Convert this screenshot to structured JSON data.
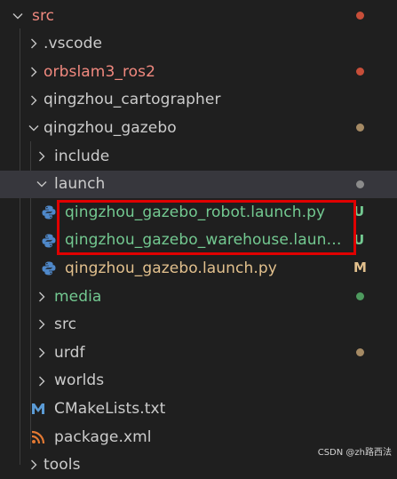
{
  "colors": {
    "default_text": "#cccccc",
    "error_text": "#f1897f",
    "untracked_text": "#73c991",
    "modified_text": "#e2c08d",
    "error_dot": "#c74e39",
    "modified_dot": "#a58a64",
    "untracked_dot": "#4e9a5e",
    "neutral_dot": "#8b8b8b",
    "highlight_border": "#e00000"
  },
  "explorer": {
    "items": [
      {
        "label": "src",
        "kind": "folder",
        "expanded": true,
        "color": "error_text",
        "status_dot": "error_dot",
        "badge": ""
      },
      {
        "label": ".vscode",
        "kind": "folder",
        "expanded": false,
        "color": "default_text",
        "status_dot": "",
        "badge": ""
      },
      {
        "label": "orbslam3_ros2",
        "kind": "folder",
        "expanded": false,
        "color": "error_text",
        "status_dot": "error_dot",
        "badge": ""
      },
      {
        "label": "qingzhou_cartographer",
        "kind": "folder",
        "expanded": false,
        "color": "default_text",
        "status_dot": "",
        "badge": ""
      },
      {
        "label": "qingzhou_gazebo",
        "kind": "folder",
        "expanded": true,
        "color": "default_text",
        "status_dot": "modified_dot",
        "badge": ""
      },
      {
        "label": "include",
        "kind": "folder",
        "expanded": false,
        "color": "default_text",
        "status_dot": "",
        "badge": ""
      },
      {
        "label": "launch",
        "kind": "folder",
        "expanded": true,
        "color": "default_text",
        "status_dot": "neutral_dot",
        "badge": ""
      },
      {
        "label": "qingzhou_gazebo_robot.launch.py",
        "kind": "python",
        "color": "untracked_text",
        "status_dot": "",
        "badge": "U"
      },
      {
        "label": "qingzhou_gazebo_warehouse.launc...",
        "kind": "python",
        "color": "untracked_text",
        "status_dot": "",
        "badge": "U"
      },
      {
        "label": "qingzhou_gazebo.launch.py",
        "kind": "python",
        "color": "modified_text",
        "status_dot": "",
        "badge": "M"
      },
      {
        "label": "media",
        "kind": "folder",
        "expanded": false,
        "color": "untracked_text",
        "status_dot": "untracked_dot",
        "badge": ""
      },
      {
        "label": "src",
        "kind": "folder",
        "expanded": false,
        "color": "default_text",
        "status_dot": "",
        "badge": ""
      },
      {
        "label": "urdf",
        "kind": "folder",
        "expanded": false,
        "color": "default_text",
        "status_dot": "modified_dot",
        "badge": ""
      },
      {
        "label": "worlds",
        "kind": "folder",
        "expanded": false,
        "color": "default_text",
        "status_dot": "",
        "badge": ""
      },
      {
        "label": "CMakeLists.txt",
        "kind": "cmake",
        "color": "default_text",
        "status_dot": "",
        "badge": ""
      },
      {
        "label": "package.xml",
        "kind": "rss",
        "color": "default_text",
        "status_dot": "",
        "badge": ""
      },
      {
        "label": "tools",
        "kind": "folder",
        "expanded": false,
        "color": "default_text",
        "status_dot": "",
        "badge": ""
      }
    ]
  },
  "watermark": "CSDN @zh路西法"
}
